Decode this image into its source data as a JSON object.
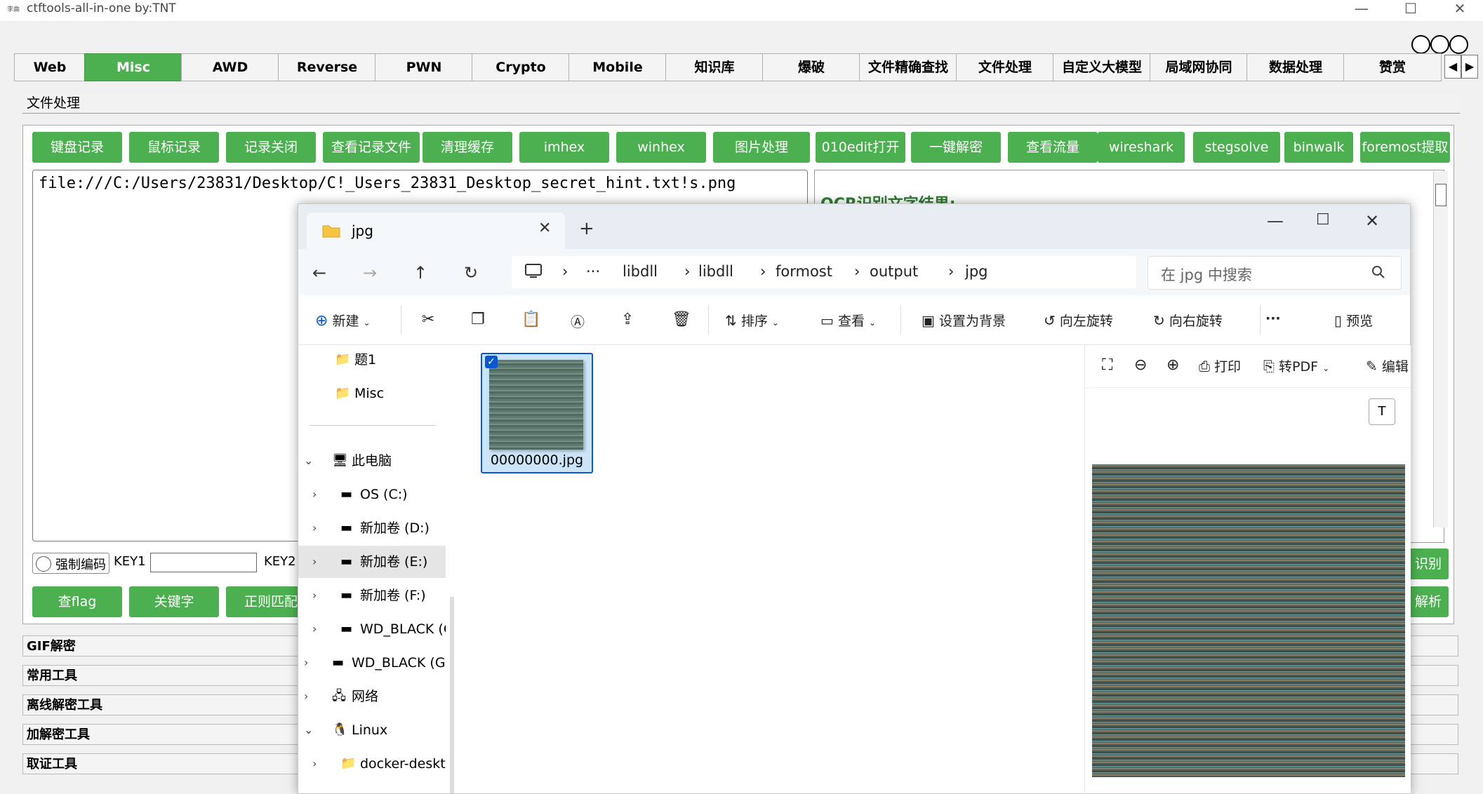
{
  "app": {
    "title": "ctftools-all-in-one   by:TNT",
    "icon_text": "李曲"
  },
  "tabs": [
    "Web",
    "Misc",
    "AWD",
    "Reverse",
    "PWN",
    "Crypto",
    "Mobile",
    "知识库",
    "爆破",
    "文件精确查找",
    "文件处理",
    "自定义大模型",
    "局域网协同",
    "数据处理",
    "赞赏"
  ],
  "active_tab": "Misc",
  "section_title": "文件处理",
  "tool_buttons": [
    "键盘记录",
    "鼠标记录",
    "记录关闭",
    "查看记录文件",
    "清理缓存",
    "imhex",
    "winhex",
    "图片处理",
    "010edit打开",
    "一键解密",
    "查看流量",
    "wireshark",
    "stegsolve",
    "binwalk",
    "foremost提取"
  ],
  "filepath_text": "file:///C:/Users/23831/Desktop/C!_Users_23831_Desktop_secret_hint.txt!s.png",
  "ocr_label": "OCR识别文字结果:",
  "options": {
    "force_encoding": "强制编码",
    "key1": "KEY1",
    "key2": "KEY2"
  },
  "bottom_buttons": [
    "查flag",
    "关键字",
    "正则匹配"
  ],
  "right_buttons": [
    "识别",
    "解析"
  ],
  "sections": [
    "GIF解密",
    "常用工具",
    "离线解密工具",
    "加解密工具",
    "取证工具"
  ],
  "explorer": {
    "tab_title": "jpg",
    "breadcrumbs": [
      "···",
      "libdll",
      "libdll",
      "formost",
      "output",
      "jpg"
    ],
    "search_placeholder": "在 jpg 中搜索",
    "commands": {
      "new": "新建",
      "sort": "排序",
      "view": "查看",
      "set_bg": "设置为背景",
      "rotate_left": "向左旋转",
      "rotate_right": "向右旋转",
      "more": "···",
      "preview": "预览"
    },
    "nav_items": [
      {
        "label": "题1"
      },
      {
        "label": "Misc"
      },
      {
        "label": "此电脑"
      },
      {
        "label": "OS (C:)"
      },
      {
        "label": "新加卷 (D:)"
      },
      {
        "label": "新加卷 (E:)"
      },
      {
        "label": "新加卷 (F:)"
      },
      {
        "label": "WD_BLACK (G:)"
      },
      {
        "label": "WD_BLACK (G:)"
      },
      {
        "label": "网络"
      },
      {
        "label": "Linux"
      },
      {
        "label": "docker-desktop"
      }
    ],
    "file_name": "00000000.jpg",
    "preview_tools": {
      "print": "打印",
      "to_pdf": "转PDF",
      "edit": "编辑"
    }
  },
  "colors": {
    "accent_green": "#4caf50",
    "explorer_select": "#0b57d0"
  }
}
